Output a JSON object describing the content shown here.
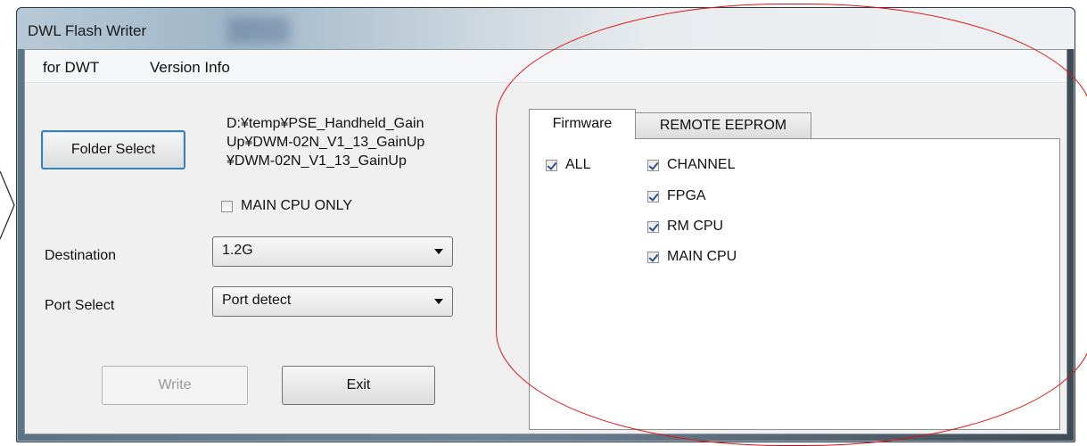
{
  "window": {
    "title": "DWL Flash Writer"
  },
  "menu": {
    "items": [
      "for DWT",
      "Version Info"
    ]
  },
  "left": {
    "folder_select_label": "Folder Select",
    "path_text": "D:¥temp¥PSE_Handheld_Gain\nUp¥DWM-02N_V1_13_GainUp\n¥DWM-02N_V1_13_GainUp",
    "main_cpu_only": {
      "label": "MAIN CPU ONLY",
      "checked": false
    },
    "destination": {
      "label": "Destination",
      "value": "1.2G"
    },
    "port_select": {
      "label": "Port Select",
      "value": "Port detect"
    },
    "write_label": "Write",
    "exit_label": "Exit"
  },
  "tabs": [
    {
      "label": "Firmware",
      "active": true
    },
    {
      "label": "REMOTE EEPROM",
      "active": false
    }
  ],
  "firmware": {
    "all": {
      "label": "ALL",
      "checked": true
    },
    "options": [
      {
        "label": "CHANNEL",
        "checked": true
      },
      {
        "label": "FPGA",
        "checked": true
      },
      {
        "label": "RM CPU",
        "checked": true
      },
      {
        "label": "MAIN CPU",
        "checked": true
      }
    ]
  },
  "colors": {
    "annotation": "#e01010",
    "folder_button_border": "#3c7fb1"
  }
}
